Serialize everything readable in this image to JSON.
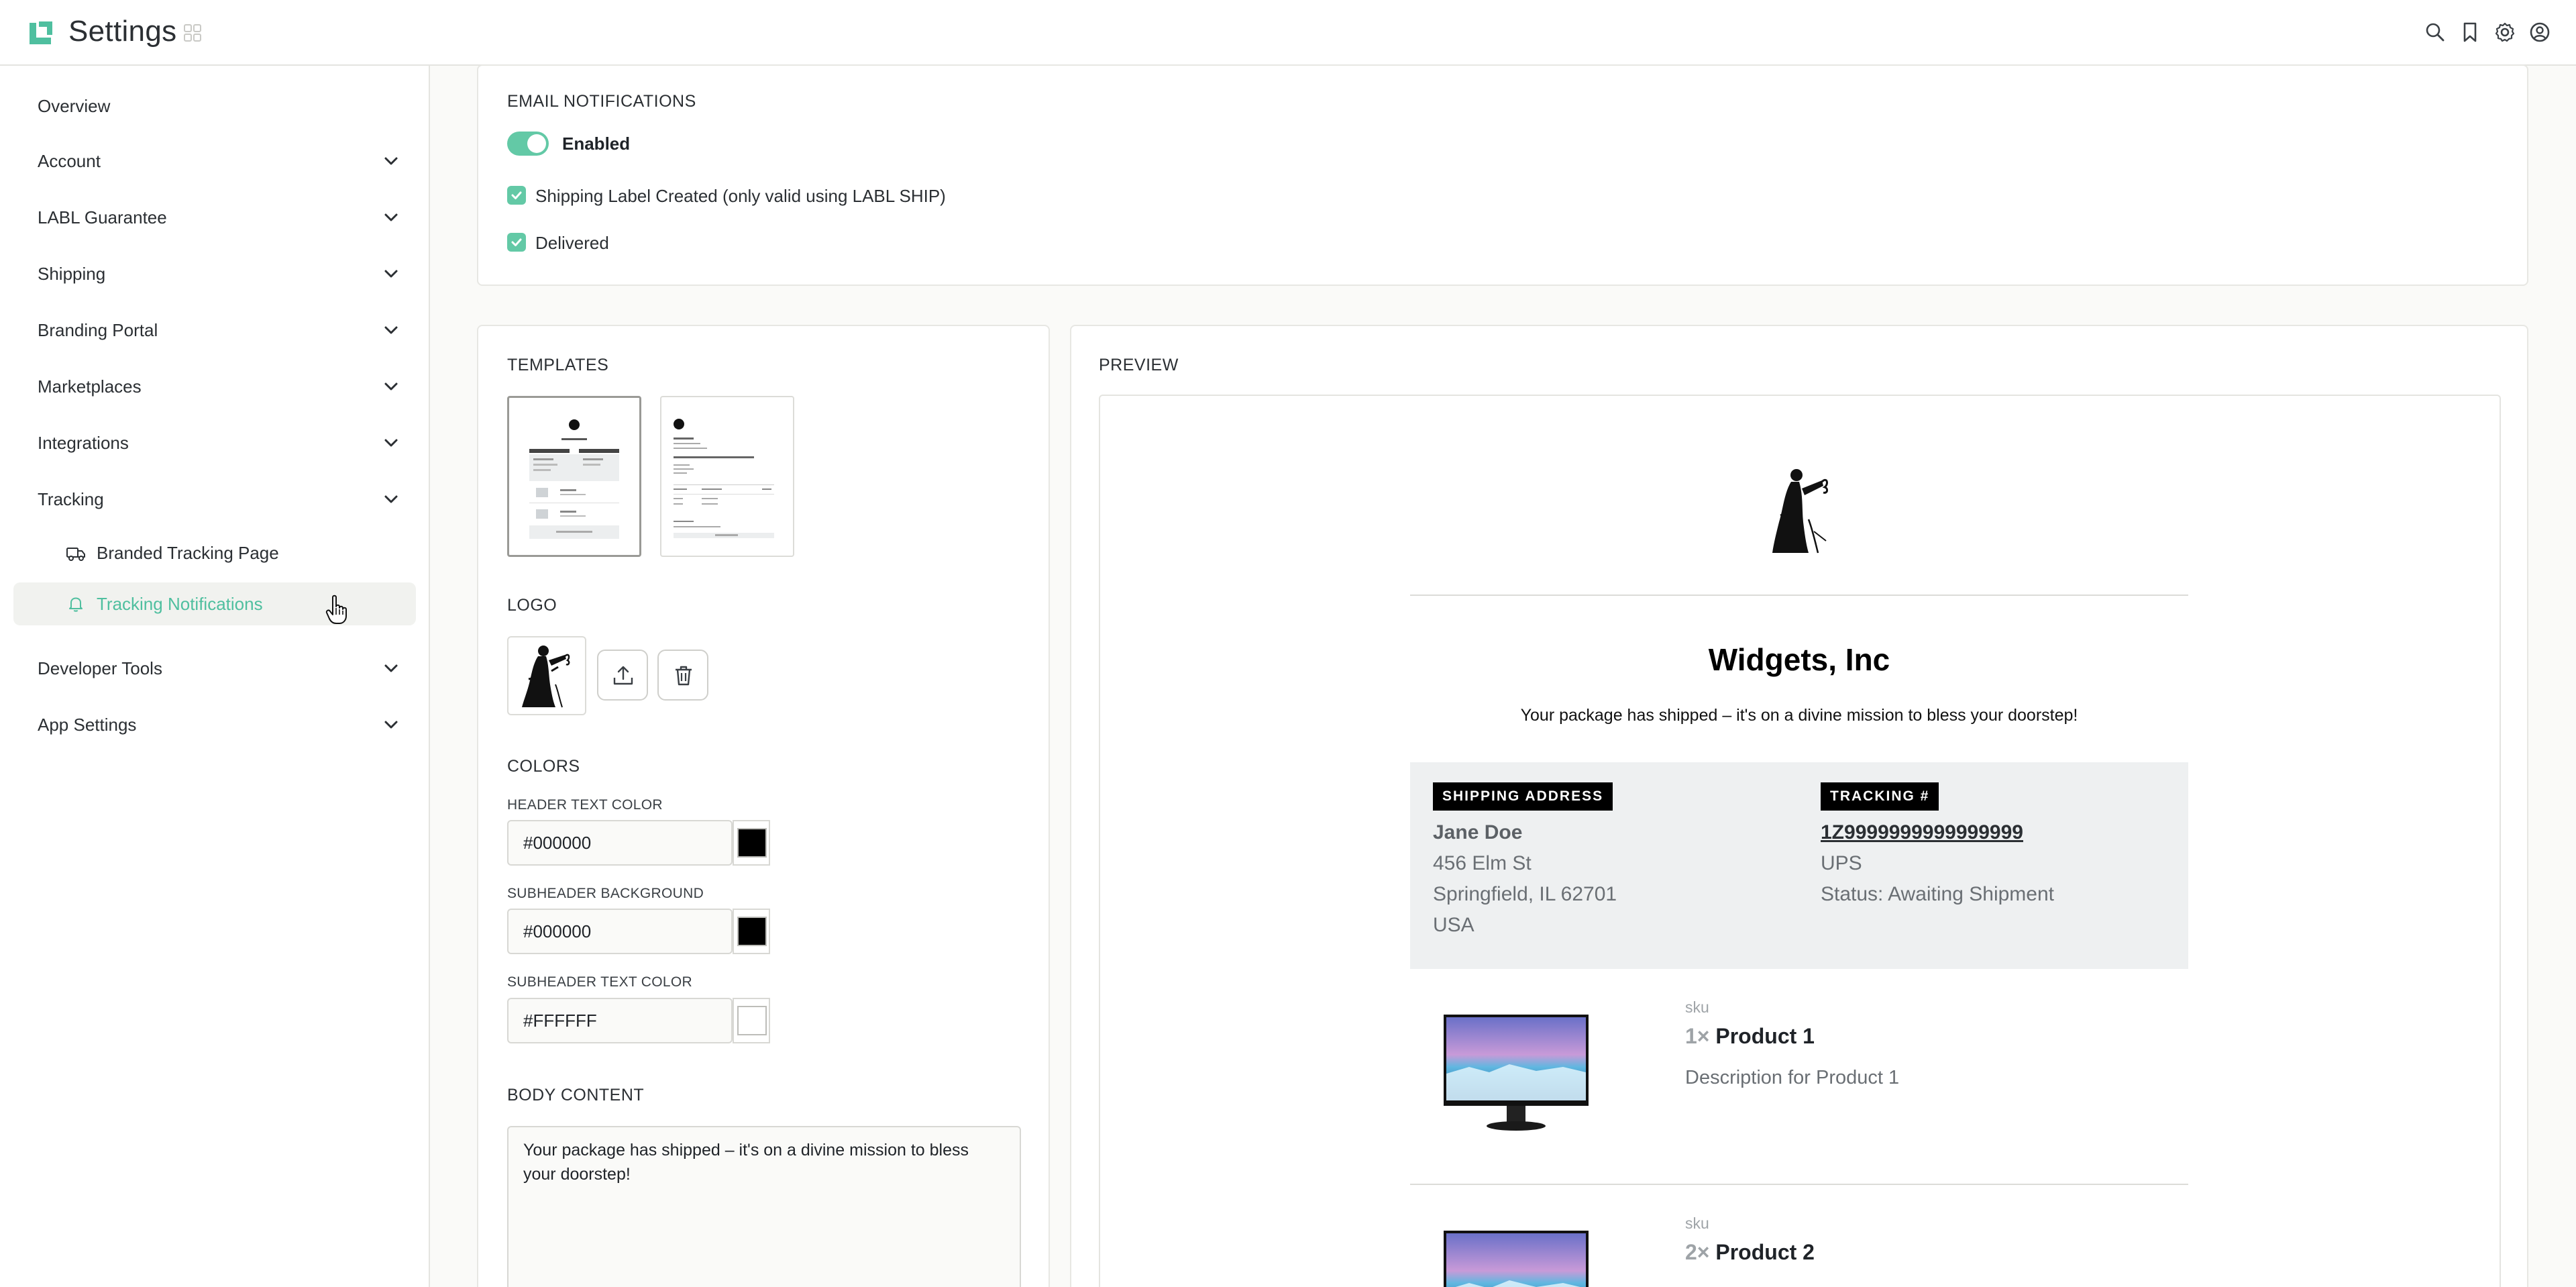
{
  "header": {
    "title": "Settings",
    "icons": [
      "search-icon",
      "bookmark-icon",
      "gear-icon",
      "user-circle-icon"
    ]
  },
  "sidebar": {
    "items": [
      {
        "label": "Overview",
        "has_chevron": false
      },
      {
        "label": "Account",
        "has_chevron": true
      },
      {
        "label": "LABL Guarantee",
        "has_chevron": true
      },
      {
        "label": "Shipping",
        "has_chevron": true
      },
      {
        "label": "Branding Portal",
        "has_chevron": true
      },
      {
        "label": "Marketplaces",
        "has_chevron": true
      },
      {
        "label": "Integrations",
        "has_chevron": true
      },
      {
        "label": "Tracking",
        "has_chevron": true,
        "expanded": true
      },
      {
        "label": "Developer Tools",
        "has_chevron": true
      },
      {
        "label": "App Settings",
        "has_chevron": true
      }
    ],
    "tracking_subitems": [
      {
        "label": "Branded Tracking Page",
        "icon": "truck-icon",
        "active": false
      },
      {
        "label": "Tracking Notifications",
        "icon": "bell-icon",
        "active": true
      }
    ]
  },
  "email_notifications": {
    "title": "EMAIL NOTIFICATIONS",
    "toggle_label": "Enabled",
    "toggle_on": true,
    "checkboxes": [
      {
        "label": "Shipping Label Created (only valid using LABL SHIP)",
        "checked": true
      },
      {
        "label": "Delivered",
        "checked": true
      }
    ]
  },
  "templates": {
    "title": "TEMPLATES",
    "selected_index": 0
  },
  "logo": {
    "title": "LOGO"
  },
  "colors": {
    "title": "COLORS",
    "fields": [
      {
        "label": "HEADER TEXT COLOR",
        "value": "#000000",
        "swatch": "#000000"
      },
      {
        "label": "SUBHEADER BACKGROUND",
        "value": "#000000",
        "swatch": "#000000"
      },
      {
        "label": "SUBHEADER TEXT COLOR",
        "value": "#FFFFFF",
        "swatch": "#FFFFFF"
      }
    ]
  },
  "body_content": {
    "title": "BODY CONTENT",
    "value": "Your package has shipped – it's on a divine mission to bless your doorstep!"
  },
  "preview": {
    "title": "PREVIEW",
    "company": "Widgets, Inc",
    "subheader": "Your package has shipped – it's on a divine mission to bless your doorstep!",
    "shipping_tag": "SHIPPING ADDRESS",
    "tracking_tag": "TRACKING #",
    "address": {
      "name": "Jane Doe",
      "street": "456 Elm St",
      "city": "Springfield, IL 62701",
      "country": "USA"
    },
    "tracking": {
      "number": "1Z9999999999999999",
      "carrier": "UPS",
      "status": "Status: Awaiting Shipment"
    },
    "products": [
      {
        "sku": "sku",
        "qty": "1×",
        "name": "Product 1",
        "description": "Description for Product 1"
      },
      {
        "sku": "sku",
        "qty": "2×",
        "name": "Product 2"
      }
    ]
  },
  "theme": {
    "accent": "#63c9a6",
    "active_text": "#4fbf9f"
  }
}
